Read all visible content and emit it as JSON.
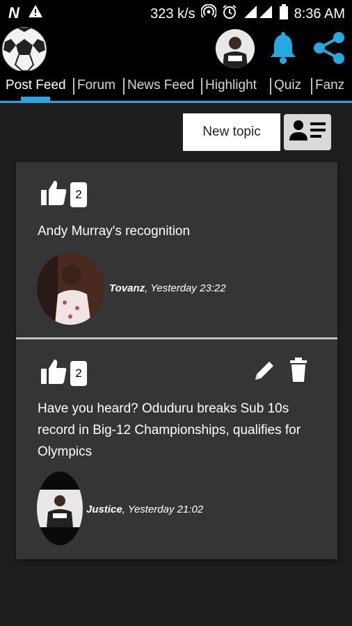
{
  "status_bar": {
    "left_icons": [
      "n-icon",
      "warning-icon"
    ],
    "n_glyph": "N",
    "speed": "323 k/s",
    "time": "8:36 AM",
    "right_icons": [
      "hotspot-icon",
      "alarm-icon",
      "signal-icon",
      "battery-icon"
    ]
  },
  "app_bar": {
    "logo": "soccer-ball-icon",
    "icons": [
      "profile-avatar",
      "bell-icon",
      "share-icon"
    ],
    "accent_color": "#26a9e0"
  },
  "tabs": {
    "items": [
      {
        "label": "Post Feed",
        "active": true
      },
      {
        "label": "Forum"
      },
      {
        "label": "News Feed"
      },
      {
        "label": "Highlight"
      },
      {
        "label": "Quiz"
      },
      {
        "label": "Fanz"
      }
    ]
  },
  "toolbar": {
    "new_topic_label": "New topic",
    "profile_card_icon": "contact-card-icon"
  },
  "posts": [
    {
      "likes": "2",
      "text": "Andy Murray's recognition",
      "author": "Tovanz",
      "time": ", Yesterday 23:22",
      "can_edit": false
    },
    {
      "likes": "2",
      "text": "Have you heard? Oduduru breaks Sub 10s record in Big-12 Championships, qualifies for Olympics",
      "author": "Justice",
      "time": ", Yesterday 21:02",
      "can_edit": true
    }
  ]
}
